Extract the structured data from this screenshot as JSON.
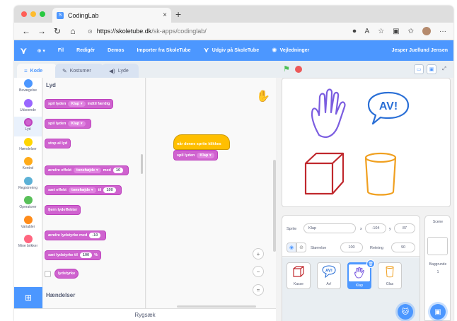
{
  "browser": {
    "tab_title": "CodingLab",
    "tab_favicon": "S",
    "url_host": "https://skoletube.dk",
    "url_path": "/sk-apps/codinglab/",
    "nav": {
      "back": "←",
      "forward": "→",
      "reload": "↻",
      "home": "⌂"
    },
    "new_tab": "+",
    "close": "×"
  },
  "menu": {
    "items": [
      "Fil",
      "Redigér",
      "Demos",
      "Importer fra SkoleTube",
      "Udgiv på SkoleTube",
      "Vejledninger"
    ],
    "user": "Jesper Juellund Jensen"
  },
  "editor_tabs": [
    {
      "label": "Kode",
      "icon": "code-icon"
    },
    {
      "label": "Kostumer",
      "icon": "brush-icon"
    },
    {
      "label": "Lyde",
      "icon": "speaker-icon"
    }
  ],
  "categories": [
    {
      "label": "Bevægelse",
      "color": "#4c97ff"
    },
    {
      "label": "Udseende",
      "color": "#9966ff"
    },
    {
      "label": "Lyd",
      "color": "#cf63cf"
    },
    {
      "label": "Hændelser",
      "color": "#ffd500"
    },
    {
      "label": "Kontrol",
      "color": "#ffab19"
    },
    {
      "label": "Registrering",
      "color": "#5cb1d6"
    },
    {
      "label": "Operatorer",
      "color": "#59c059"
    },
    {
      "label": "Variabler",
      "color": "#ff8c1a"
    },
    {
      "label": "Mine brikker",
      "color": "#ff6680"
    }
  ],
  "palette": {
    "heading_sound": "Lyd",
    "heading_events": "Hændelser",
    "blocks": {
      "play_until_done": {
        "a": "spil lyden",
        "dd": "Klap",
        "b": "indtil færdig"
      },
      "start_sound": {
        "a": "spil lyden",
        "dd": "Klap"
      },
      "stop_all": {
        "a": "stop al lyd"
      },
      "change_effect": {
        "a": "ændre effekt",
        "dd": "tonehøjde",
        "b": "med",
        "num": "10"
      },
      "set_effect": {
        "a": "sæt effekt",
        "dd": "tonehøjde",
        "b": "til",
        "num": "100"
      },
      "clear_effects": {
        "a": "fjern lydeffekter"
      },
      "change_volume": {
        "a": "ændre lydstyrke med",
        "num": "-10"
      },
      "set_volume": {
        "a": "sæt lydstyrke til",
        "num": "100",
        "b": "%"
      },
      "volume": {
        "a": "lydstyrke"
      }
    }
  },
  "script": {
    "hat": "når denne sprite klikkes",
    "block": {
      "a": "spil lyden",
      "dd": "Klap"
    }
  },
  "zoom": {
    "in": "+",
    "out": "−",
    "reset": "="
  },
  "backpack": "Rygsæk",
  "sprite_info": {
    "sprite_label": "Sprite",
    "sprite_name": "Klap",
    "x_label": "x",
    "x": "-104",
    "y_label": "y",
    "y": "87",
    "size_label": "Størrelse",
    "size": "100",
    "direction_label": "Retning",
    "direction": "90"
  },
  "sprites": [
    {
      "name": "Kasse",
      "icon": "box-icon"
    },
    {
      "name": "Av!",
      "icon": "speech-bubble-icon"
    },
    {
      "name": "Klap",
      "icon": "hand-icon"
    },
    {
      "name": "Glas",
      "icon": "glass-icon"
    }
  ],
  "stage_panel": {
    "title": "Scene",
    "backdrops_label": "Baggrunde",
    "backdrops_count": "1"
  },
  "stage_art": {
    "speech_text": "AV!"
  },
  "colors": {
    "accent": "#4c97ff",
    "sound": "#cf63cf",
    "events": "#ffbf00"
  }
}
